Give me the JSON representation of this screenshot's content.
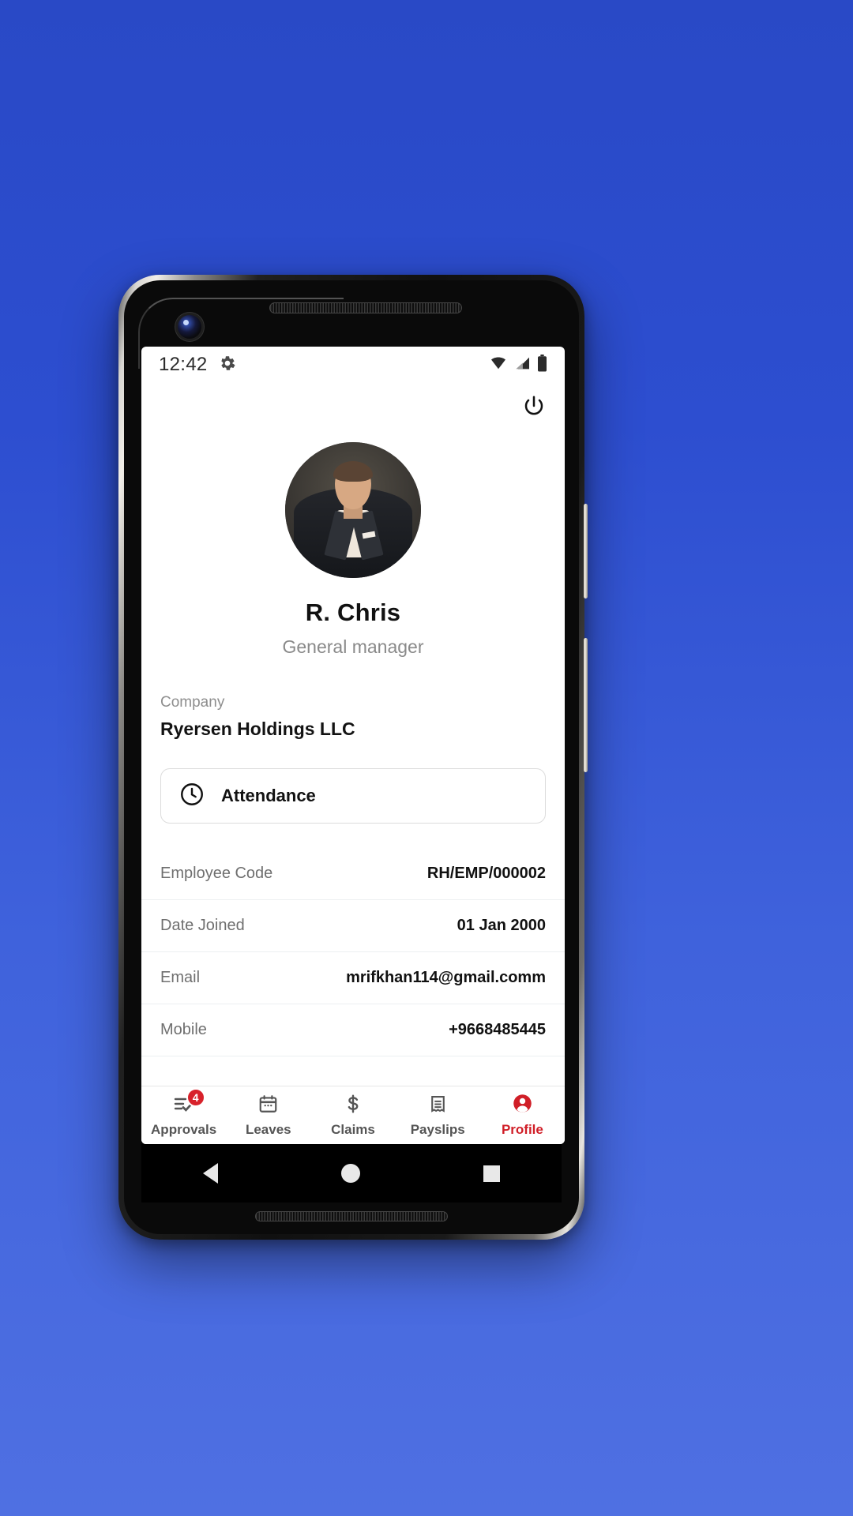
{
  "status_bar": {
    "time": "12:42",
    "left_icons": [
      "gear-icon"
    ],
    "right_icons": [
      "wifi-icon",
      "signal-icon",
      "battery-icon"
    ]
  },
  "header": {
    "power_icon": "power-icon"
  },
  "profile": {
    "avatar": "user-avatar-photo",
    "name": "R. Chris",
    "role": "General manager"
  },
  "company": {
    "label": "Company",
    "value": "Ryersen Holdings LLC"
  },
  "attendance": {
    "icon": "clock-icon",
    "label": "Attendance"
  },
  "details": [
    {
      "label": "Employee Code",
      "value": "RH/EMP/000002"
    },
    {
      "label": "Date Joined",
      "value": "01 Jan 2000"
    },
    {
      "label": "Email",
      "value": "mrifkhan114@gmail.comm"
    },
    {
      "label": "Mobile",
      "value": "+9668485445"
    }
  ],
  "tabs": [
    {
      "label": "Approvals",
      "icon": "approvals-checklist-icon",
      "badge": "4",
      "active": false
    },
    {
      "label": "Leaves",
      "icon": "calendar-icon",
      "badge": "",
      "active": false
    },
    {
      "label": "Claims",
      "icon": "dollar-icon",
      "badge": "",
      "active": false
    },
    {
      "label": "Payslips",
      "icon": "receipt-icon",
      "badge": "",
      "active": false
    },
    {
      "label": "Profile",
      "icon": "person-circle-icon",
      "badge": "",
      "active": true
    }
  ],
  "android_nav": {
    "back": "back-triangle-icon",
    "home": "home-circle-icon",
    "recents": "recents-square-icon"
  },
  "colors": {
    "background": "#2d4ed0",
    "accent_red": "#d01e27",
    "badge_red": "#d8222b",
    "text_primary": "#111111",
    "text_muted": "#8a8a8a"
  }
}
